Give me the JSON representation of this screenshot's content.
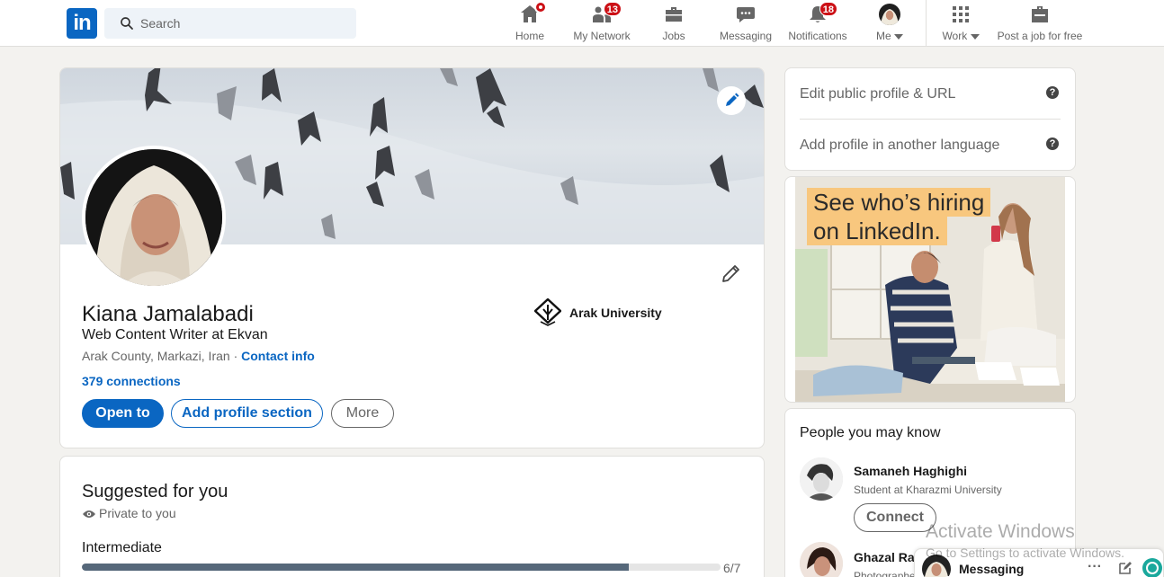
{
  "nav": {
    "logo_text": "in",
    "search_placeholder": "Search",
    "items": [
      {
        "label": "Home",
        "icon": "home-icon",
        "badge": ""
      },
      {
        "label": "My Network",
        "icon": "network-icon",
        "badge": "13"
      },
      {
        "label": "Jobs",
        "icon": "briefcase-icon",
        "badge": ""
      },
      {
        "label": "Messaging",
        "icon": "chat-icon",
        "badge": ""
      },
      {
        "label": "Notifications",
        "icon": "bell-icon",
        "badge": "18"
      },
      {
        "label": "Me",
        "icon": "avatar",
        "badge": ""
      },
      {
        "label": "Work",
        "icon": "grid-icon",
        "badge": ""
      },
      {
        "label": "Post a job for free",
        "icon": "post-job-icon",
        "badge": ""
      }
    ],
    "colors": {
      "brand": "#0a66c2",
      "badge": "#cc1016"
    }
  },
  "profile": {
    "name": "Kiana Jamalabadi",
    "headline": "Web Content Writer at Ekvan",
    "location": "Arak County, Markazi, Iran",
    "location_separator": " · ",
    "contact_info": "Contact info",
    "connections": "379 connections",
    "education": "Arak University",
    "buttons": {
      "open_to": "Open to",
      "add_section": "Add profile section",
      "more": "More"
    }
  },
  "suggested": {
    "title": "Suggested for you",
    "privacy": "Private to you",
    "level": "Intermediate",
    "progress_label": "6/7",
    "progress_fraction": 0.857
  },
  "sidebar": {
    "links": [
      {
        "label": "Edit public profile & URL",
        "help": "?"
      },
      {
        "label": "Add profile in another language",
        "help": "?"
      }
    ],
    "ad": {
      "line1": "See who’s hiring",
      "line2": "on LinkedIn."
    },
    "pymk": {
      "title": "People you may know",
      "people": [
        {
          "name": "Samaneh Haghighi",
          "headline": "Student at Kharazmi University",
          "action": "Connect"
        },
        {
          "name": "Ghazal Rae",
          "headline": "Photographe"
        }
      ]
    }
  },
  "messaging": {
    "label": "Messaging",
    "more": "···"
  },
  "watermark": {
    "line1": "Activate Windows",
    "line2": "Go to Settings to activate Windows."
  }
}
